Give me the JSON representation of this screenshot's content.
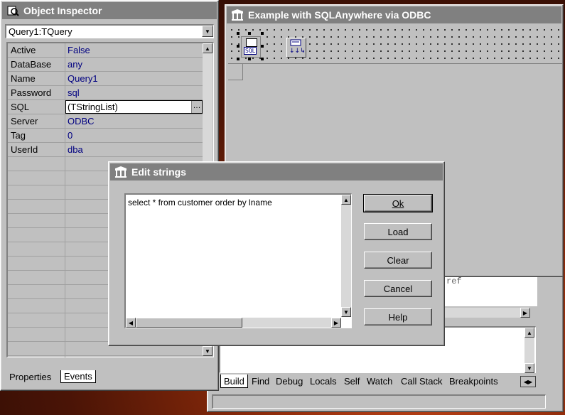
{
  "object_inspector": {
    "title": "Object Inspector",
    "selected_component": "Query1:TQuery",
    "properties": [
      {
        "name": "Active",
        "value": "False"
      },
      {
        "name": "DataBase",
        "value": "any"
      },
      {
        "name": "Name",
        "value": "Query1"
      },
      {
        "name": "Password",
        "value": "sql"
      },
      {
        "name": "SQL",
        "value": "(TStringList)"
      },
      {
        "name": "Server",
        "value": "ODBC"
      },
      {
        "name": "Tag",
        "value": "0"
      },
      {
        "name": "UserId",
        "value": "dba"
      }
    ],
    "tabs": {
      "properties": "Properties",
      "events": "Events"
    }
  },
  "form_window": {
    "title": "Example with SQLAnywhere via ODBC",
    "sql_icon_label": "SQL"
  },
  "edit_dialog": {
    "title": "Edit strings",
    "text": "select * from customer order by lname",
    "buttons": {
      "ok": "Ok",
      "load": "Load",
      "clear": "Clear",
      "cancel": "Cancel",
      "help": "Help"
    }
  },
  "debug_window": {
    "background_text": "ref",
    "tabs": [
      "Build",
      "Find",
      "Debug",
      "Locals",
      "Self",
      "Watch",
      "Call Stack",
      "Breakpoints"
    ]
  },
  "colors": {
    "titlebar_inactive": "#808080",
    "value_text": "#000080",
    "desktop": "#6a1c08"
  }
}
